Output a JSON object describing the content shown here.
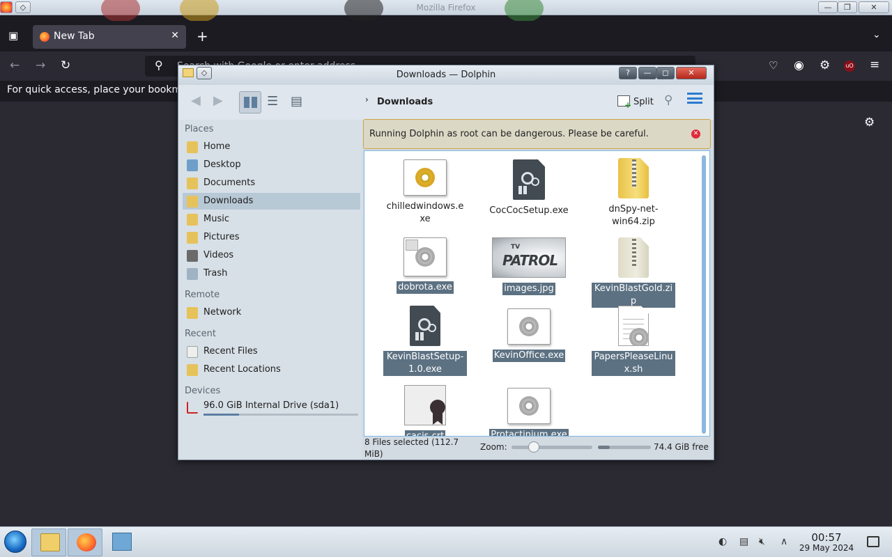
{
  "firefox": {
    "window_title": "Mozilla Firefox",
    "tab_label": "New Tab",
    "close_tab": "✕",
    "new_tab": "+",
    "address_placeholder": "Search with Google or enter address",
    "bookmarks_hint": "For quick access, place your bookmarks here on the bookmarks toolbar."
  },
  "dolphin": {
    "title": "Downloads — Dolphin",
    "breadcrumb": "Downloads",
    "split_label": "Split",
    "warning": "Running Dolphin as root can be dangerous. Please be careful.",
    "places": {
      "places_header": "Places",
      "places_items": [
        {
          "label": "Home",
          "icon": "home-folder-icon"
        },
        {
          "label": "Desktop",
          "icon": "desktop-icon"
        },
        {
          "label": "Documents",
          "icon": "documents-folder-icon"
        },
        {
          "label": "Downloads",
          "icon": "downloads-folder-icon",
          "active": true
        },
        {
          "label": "Music",
          "icon": "music-folder-icon"
        },
        {
          "label": "Pictures",
          "icon": "pictures-folder-icon"
        },
        {
          "label": "Videos",
          "icon": "videos-folder-icon"
        },
        {
          "label": "Trash",
          "icon": "trash-icon"
        }
      ],
      "remote_header": "Remote",
      "remote_items": [
        {
          "label": "Network",
          "icon": "network-folder-icon"
        }
      ],
      "recent_header": "Recent",
      "recent_items": [
        {
          "label": "Recent Files",
          "icon": "recent-files-icon"
        },
        {
          "label": "Recent Locations",
          "icon": "recent-locations-icon"
        }
      ],
      "devices_header": "Devices",
      "devices_items": [
        {
          "label": "96.0 GiB Internal Drive (sda1)",
          "icon": "hard-drive-icon",
          "usage_fraction": 0.23
        }
      ]
    },
    "files": [
      {
        "name": "chilledwindows.exe",
        "type": "exe-gold",
        "selected": false
      },
      {
        "name": "CocCocSetup.exe",
        "type": "exe-dark",
        "selected": false
      },
      {
        "name": "dnSpy-net-win64.zip",
        "type": "zip-yellow",
        "selected": false
      },
      {
        "name": "dobrota.exe",
        "type": "exe-gray",
        "selected": true
      },
      {
        "name": "images.jpg",
        "type": "image",
        "selected": true
      },
      {
        "name": "KevinBlastGold.zip",
        "type": "zip-pale",
        "selected": true
      },
      {
        "name": "KevinBlastSetup-1.0.exe",
        "type": "exe-dark",
        "selected": true
      },
      {
        "name": "KevinOffice.exe",
        "type": "exe-gray",
        "selected": true
      },
      {
        "name": "PapersPleaseLinux.sh",
        "type": "script",
        "selected": true
      },
      {
        "name": "cacis.crt",
        "type": "certificate",
        "selected": true
      },
      {
        "name": "Protactinium.exe",
        "type": "exe-gray",
        "selected": true
      }
    ],
    "image_thumb": {
      "small": "TV",
      "big": "PATROL"
    },
    "status": {
      "selection": "8 Files selected (112.7 MiB)",
      "zoom_label": "Zoom:",
      "zoom_fraction": 0.28,
      "free_space": "74.4 GiB free",
      "used_fraction": 0.23
    }
  },
  "taskbar": {
    "time": "00:57",
    "date": "29 May 2024"
  }
}
